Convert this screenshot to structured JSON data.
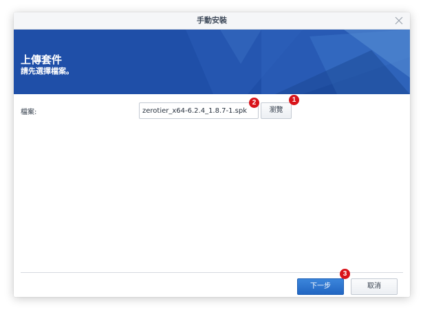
{
  "dialog": {
    "title": "手動安裝",
    "close_icon": "close-icon"
  },
  "banner": {
    "title": "上傳套件",
    "subtitle": "請先選擇檔案。"
  },
  "form": {
    "file_label": "檔案:",
    "file_value": "zerotier_x64-6.2.4_1.8.7-1.spk",
    "browse_label": "瀏覽"
  },
  "annotations": {
    "badge_1": "1",
    "badge_2": "2",
    "badge_3": "3"
  },
  "footer": {
    "next_label": "下一步",
    "cancel_label": "取消"
  },
  "colors": {
    "banner": "#1f4fa8",
    "primary_button": "#2a6fcc",
    "badge": "#d9141b"
  }
}
